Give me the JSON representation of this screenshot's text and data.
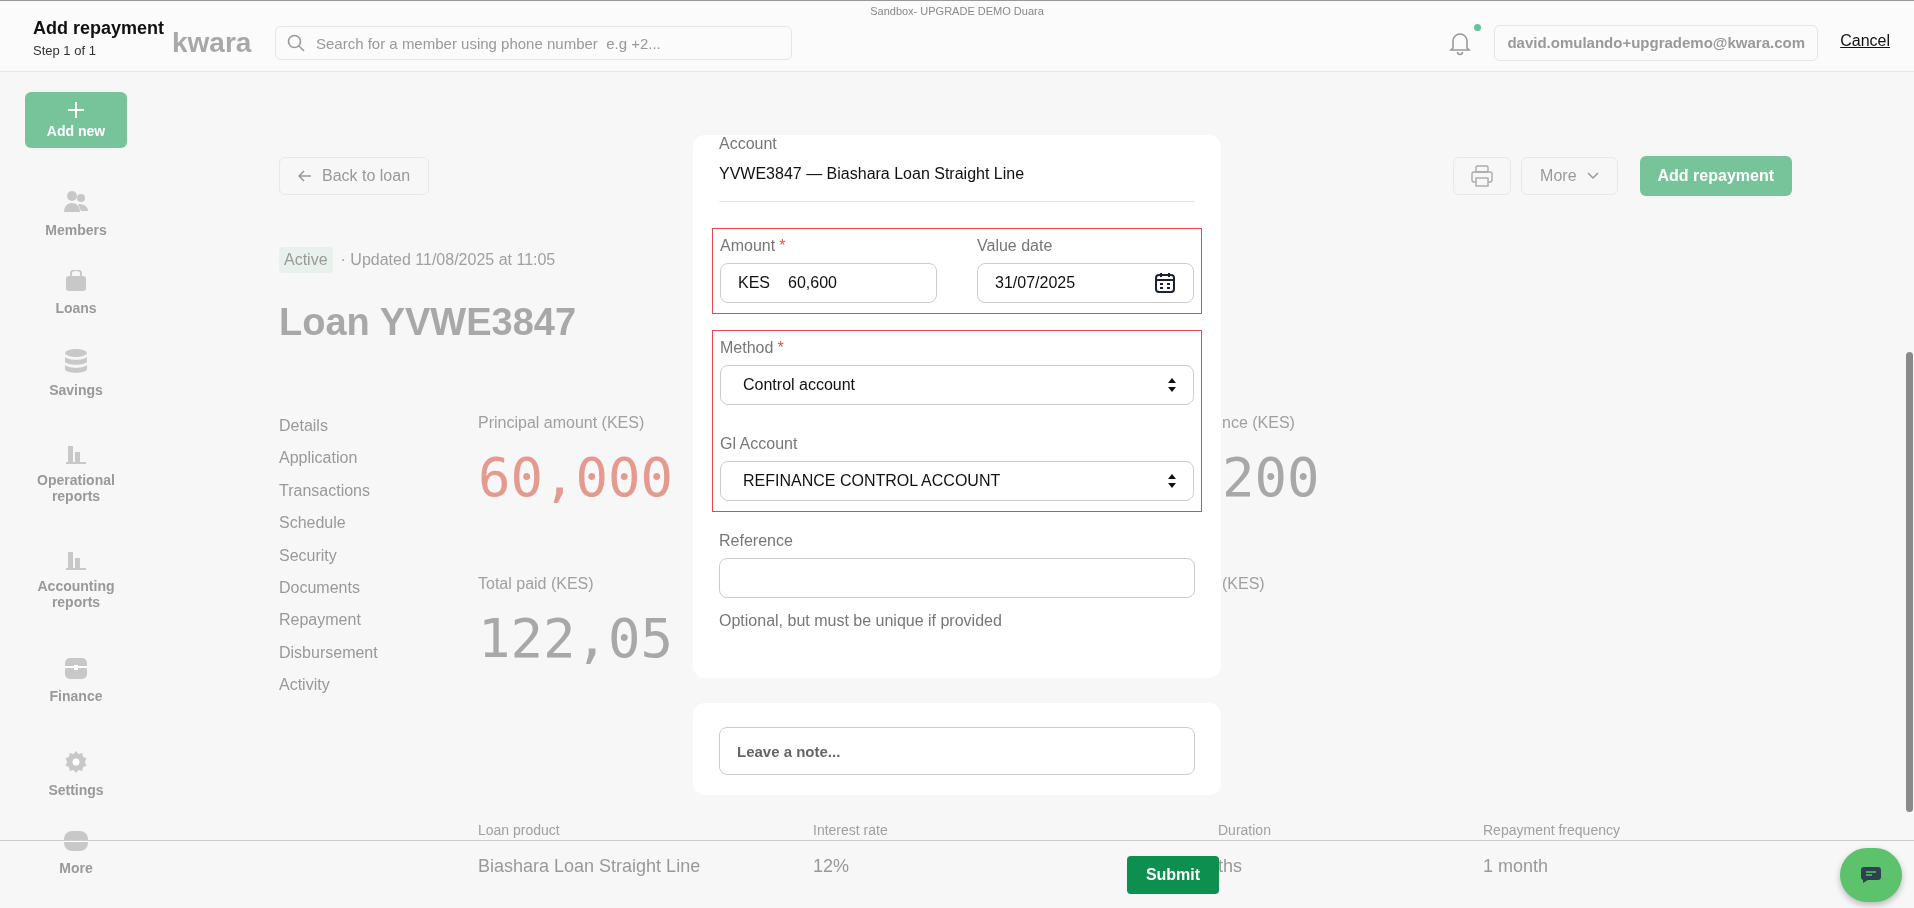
{
  "environment_banner": "Sandbox- UPGRADE DEMO Duara",
  "app_header": {
    "logo": "kwara",
    "search": {
      "placeholder": "Search for a member using phone number  e.g +2..."
    },
    "notifications_unread": true,
    "user_email": "david.omulando+upgrademo@kwara.com"
  },
  "sidebar": {
    "add_button": "Add new",
    "items": [
      {
        "label": "Members",
        "kind": "members"
      },
      {
        "label": "Loans",
        "kind": "loans"
      },
      {
        "label": "Savings",
        "kind": "savings"
      },
      {
        "label": "Operational reports",
        "kind": "reports"
      },
      {
        "label": "Accounting reports",
        "kind": "reports"
      },
      {
        "label": "Finance",
        "kind": "finance"
      },
      {
        "label": "Settings",
        "kind": "settings"
      },
      {
        "label": "More",
        "kind": "more"
      }
    ]
  },
  "page": {
    "back_button": "Back to loan",
    "more_button": "More",
    "primary_button": "Add repayment",
    "status": "Active",
    "updated": "· Updated 11/08/2025 at 11:05",
    "title": "Loan YVWE3847",
    "nav": [
      {
        "label": "Details"
      },
      {
        "label": "Application"
      },
      {
        "label": "Transactions"
      },
      {
        "label": "Schedule"
      },
      {
        "label": "Security"
      },
      {
        "label": "Documents"
      },
      {
        "label": "Repayment"
      },
      {
        "label": "Disbursement"
      },
      {
        "label": "Activity"
      }
    ],
    "stats": [
      {
        "label": "Principal amount (KES)",
        "value": "60,000",
        "negative": true
      },
      {
        "label": "nce (KES)",
        "value": "200",
        "negative": false
      },
      {
        "label": "Total paid (KES)",
        "value": "122,05",
        "negative": false
      },
      {
        "label": "(KES)"
      }
    ],
    "details": [
      {
        "label": "Loan product",
        "value": "Biashara Loan Straight Line"
      },
      {
        "label": "Interest rate",
        "value": "12%"
      },
      {
        "label": "Duration",
        "value": "ths"
      },
      {
        "label": "Repayment frequency",
        "value": "1 month"
      }
    ]
  },
  "dialog": {
    "title": "Add repayment",
    "step": "Step 1 of 1",
    "cancel": "Cancel",
    "account": {
      "label": "Account",
      "value": "YVWE3847 — Biashara Loan Straight Line"
    },
    "field_groups": [
      {
        "highlighted": true,
        "inline": true,
        "fields": [
          {
            "kind": "money",
            "label": "Amount",
            "required_mark": "*",
            "prefix": "KES",
            "value": "60,600"
          },
          {
            "kind": "date",
            "label": "Value date",
            "value": "31/07/2025"
          }
        ]
      },
      {
        "highlighted": true,
        "inline": false,
        "fields": [
          {
            "kind": "select",
            "label": "Method",
            "required_mark": "*",
            "value": "Control account"
          },
          {
            "kind": "select",
            "label": "Gl Account",
            "value": "REFINANCE CONTROL ACCOUNT"
          }
        ]
      }
    ],
    "reference": {
      "label": "Reference",
      "help": "Optional, but must be unique if provided"
    },
    "note": {
      "placeholder": "Leave a note..."
    },
    "submit": "Submit"
  }
}
